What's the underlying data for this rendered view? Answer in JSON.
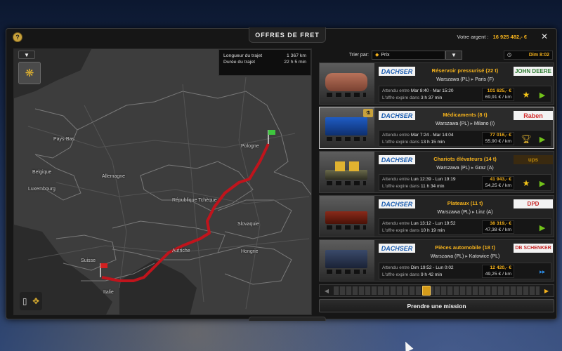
{
  "window": {
    "title": "OFFRES DE FRET",
    "money_label": "Votre argent :",
    "money_value": "16 925 482,- €",
    "close_symbol": "✕",
    "help_symbol": "?"
  },
  "map": {
    "route_length_label": "Longueur du trajet",
    "route_length_value": "1 367 km",
    "route_duration_label": "Durée du trajet",
    "route_duration_value": "22 h 5 min",
    "regions": [
      "Pays-Bas",
      "Belgique",
      "Luxembourg",
      "Allemagne",
      "Pologne",
      "République Tchèque",
      "Slovaquie",
      "Autriche",
      "Hongrie",
      "Suisse",
      "Italie"
    ]
  },
  "sort": {
    "label": "Trier par:",
    "selected": "Prix"
  },
  "clock": {
    "value": "Dim 8:02"
  },
  "offers": [
    {
      "company": "DACHSER",
      "cargo": "Réservoir pressurisé (22 t)",
      "from": "Warszawa (PL)",
      "to": "Paris (F)",
      "client": "JOHN DEERE",
      "client_color": "#2e7d32",
      "wait_label": "Attendu entre",
      "wait_value": "Mar 8:40 - Mar 15:20",
      "expire_label": "L'offre expire dans",
      "expire_value": "3 h 37 min",
      "price": "101 625,- €",
      "rate": "69,91 € / km",
      "icon": "star-icon",
      "go": "play-icon"
    },
    {
      "company": "DACHSER",
      "cargo": "Médicaments (8 t)",
      "from": "Warszawa (PL)",
      "to": "Milano (I)",
      "client": "Raben",
      "client_color": "#d32f2f",
      "wait_label": "Attendu entre",
      "wait_value": "Mar 7:24 - Mar 14:04",
      "expire_label": "L'offre expire dans",
      "expire_value": "13 h 15 min",
      "price": "77 016,- €",
      "rate": "55,90 € / km",
      "icon": "trophy-icon",
      "go": "play-icon"
    },
    {
      "company": "DACHSER",
      "cargo": "Chariots élévateurs (14 t)",
      "from": "Warszawa (PL)",
      "to": "Graz (A)",
      "client": "ups",
      "client_color": "#b8860b",
      "wait_label": "Attendu entre",
      "wait_value": "Lun 12:39 - Lun 19:19",
      "expire_label": "L'offre expire dans",
      "expire_value": "11 h 34 min",
      "price": "41 943,- €",
      "rate": "54,25 € / km",
      "icon": "star-icon",
      "go": "play-icon"
    },
    {
      "company": "DACHSER",
      "cargo": "Plateaux (11 t)",
      "from": "Warszawa (PL)",
      "to": "Linz (A)",
      "client": "DPD",
      "client_color": "#c62828",
      "wait_label": "Attendu entre",
      "wait_value": "Lun 13:12 - Lun 19:52",
      "expire_label": "L'offre expire dans",
      "expire_value": "10 h 19 min",
      "price": "38 319,- €",
      "rate": "47,38 € / km",
      "icon": "",
      "go": "play-icon"
    },
    {
      "company": "DACHSER",
      "cargo": "Pièces automobile (18 t)",
      "from": "Warszawa (PL)",
      "to": "Katowice (PL)",
      "client": "DB SCHENKER",
      "client_color": "#c62828",
      "wait_label": "Attendu entre",
      "wait_value": "Dim 19:52 - Lun 0:02",
      "expire_label": "L'offre expire dans",
      "expire_value": "9 h 42 min",
      "price": "12 420,- €",
      "rate": "49,25 € / km",
      "icon": "",
      "go": "fast-forward-icon"
    }
  ],
  "take_mission": "Prendre une mission",
  "colors": {
    "accent": "#f5b21c",
    "route": "#c0141c",
    "go": "#72c21a"
  }
}
